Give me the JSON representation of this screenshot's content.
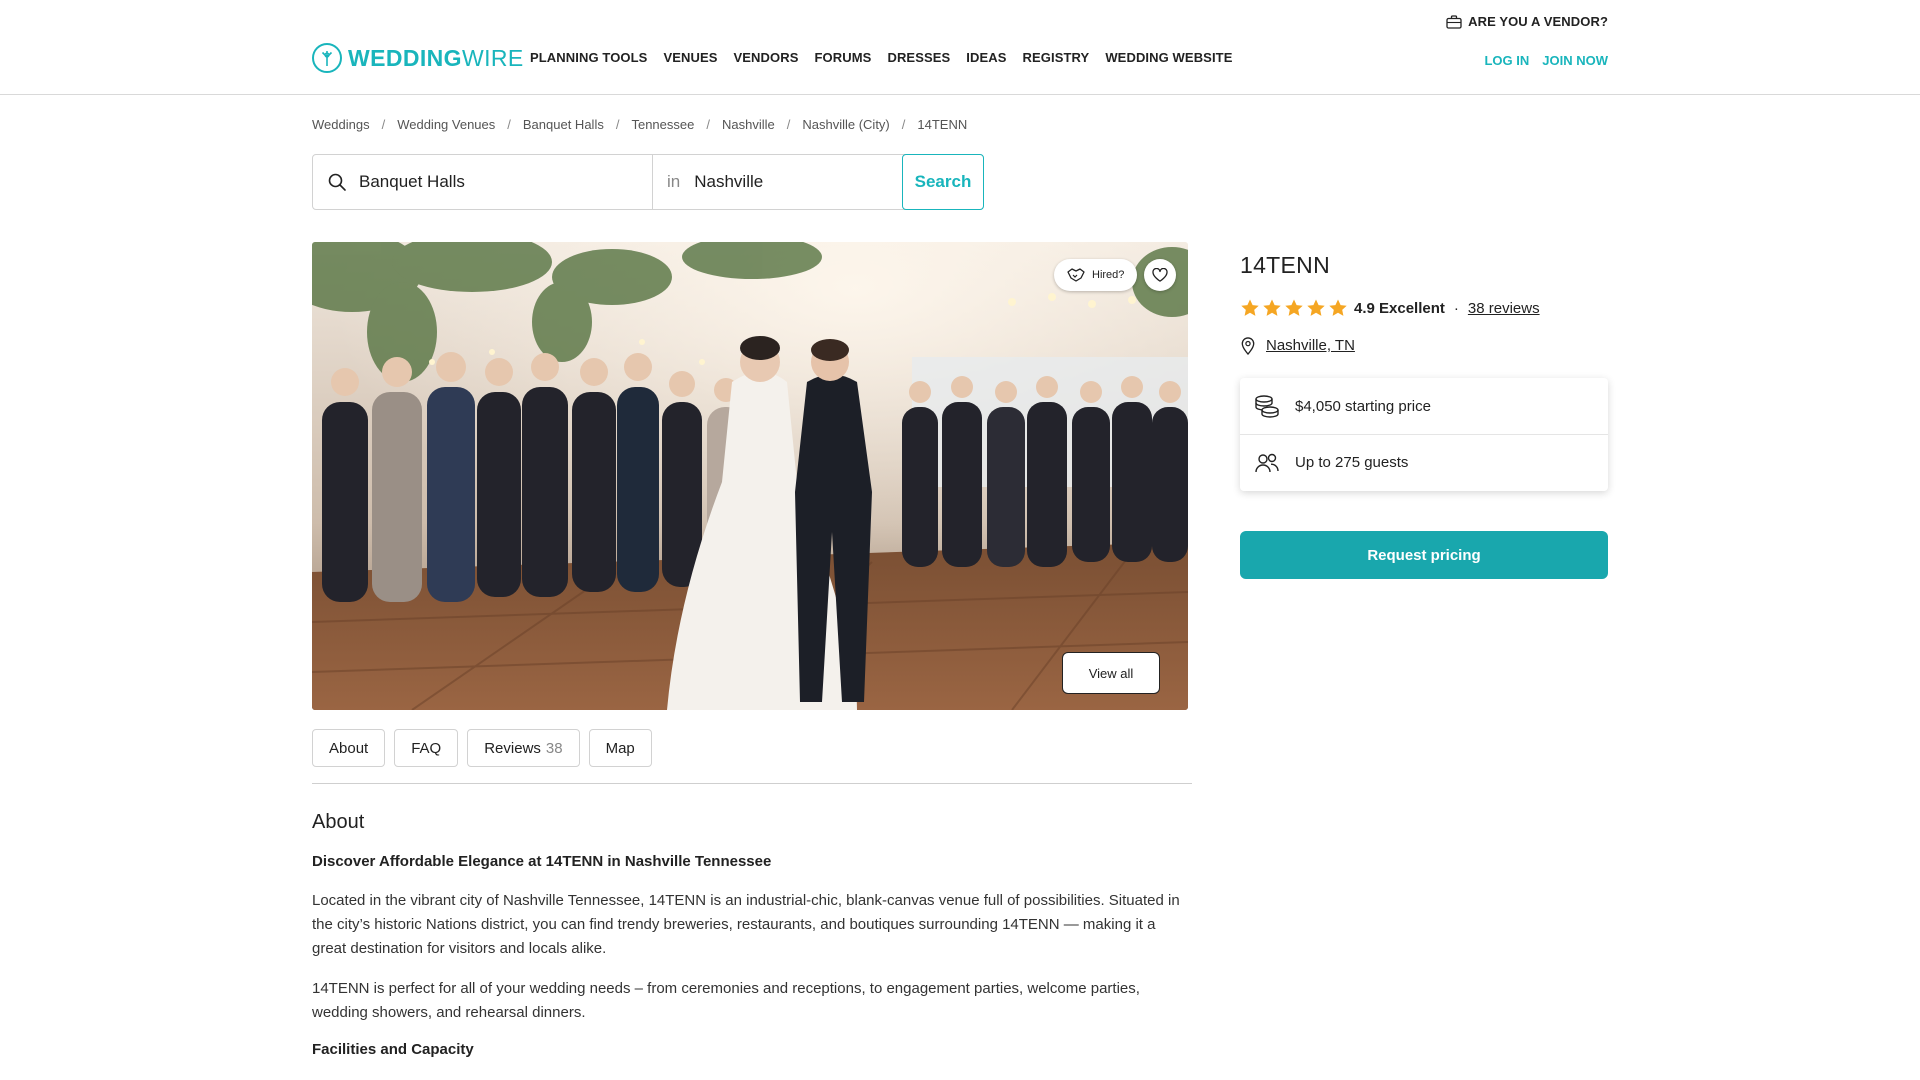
{
  "colors": {
    "brand": "#19b5bc",
    "cta": "#19a7ad",
    "star": "#f5a623",
    "text": "#222222"
  },
  "header": {
    "vendor_link": "ARE YOU A VENDOR?",
    "logo_bold": "WEDDING",
    "logo_light": "WIRE",
    "nav": [
      "PLANNING TOOLS",
      "VENUES",
      "VENDORS",
      "FORUMS",
      "DRESSES",
      "IDEAS",
      "REGISTRY",
      "WEDDING WEBSITE"
    ],
    "login": "LOG IN",
    "join": "JOIN NOW"
  },
  "breadcrumb": {
    "items": [
      "Weddings",
      "Wedding Venues",
      "Banquet Halls",
      "Tennessee",
      "Nashville",
      "Nashville (City)",
      "14TENN"
    ],
    "separator": "/"
  },
  "search": {
    "category_value": "Banquet Halls",
    "in_label": "in",
    "location_value": "Nashville",
    "button": "Search"
  },
  "gallery": {
    "hired_label": "Hired?",
    "view_all": "View all"
  },
  "tabs": {
    "about": "About",
    "faq": "FAQ",
    "reviews": "Reviews",
    "reviews_count": "38",
    "map": "Map"
  },
  "about": {
    "heading": "About",
    "subheading": "Discover Affordable Elegance at 14TENN in Nashville Tennessee",
    "paragraph1": "Located in the vibrant city of Nashville Tennessee, 14TENN is an industrial-chic, blank-canvas venue full of possibilities. Situated in the city’s historic Nations district, you can find trendy breweries, restaurants, and boutiques surrounding 14TENN — making it a great destination for visitors and locals alike.",
    "paragraph2": "14TENN is perfect for all of your wedding needs – from ceremonies and receptions, to engagement parties, welcome parties, wedding showers, and rehearsal dinners.",
    "next_heading": "Facilities and Capacity"
  },
  "venue": {
    "name": "14TENN",
    "rating_stars": 5,
    "rating": "4.9 Excellent",
    "separator": "·",
    "reviews_link": "38 reviews",
    "location": "Nashville, TN",
    "price": "$4,050 starting price",
    "guests": "Up to 275 guests",
    "cta": "Request pricing"
  }
}
